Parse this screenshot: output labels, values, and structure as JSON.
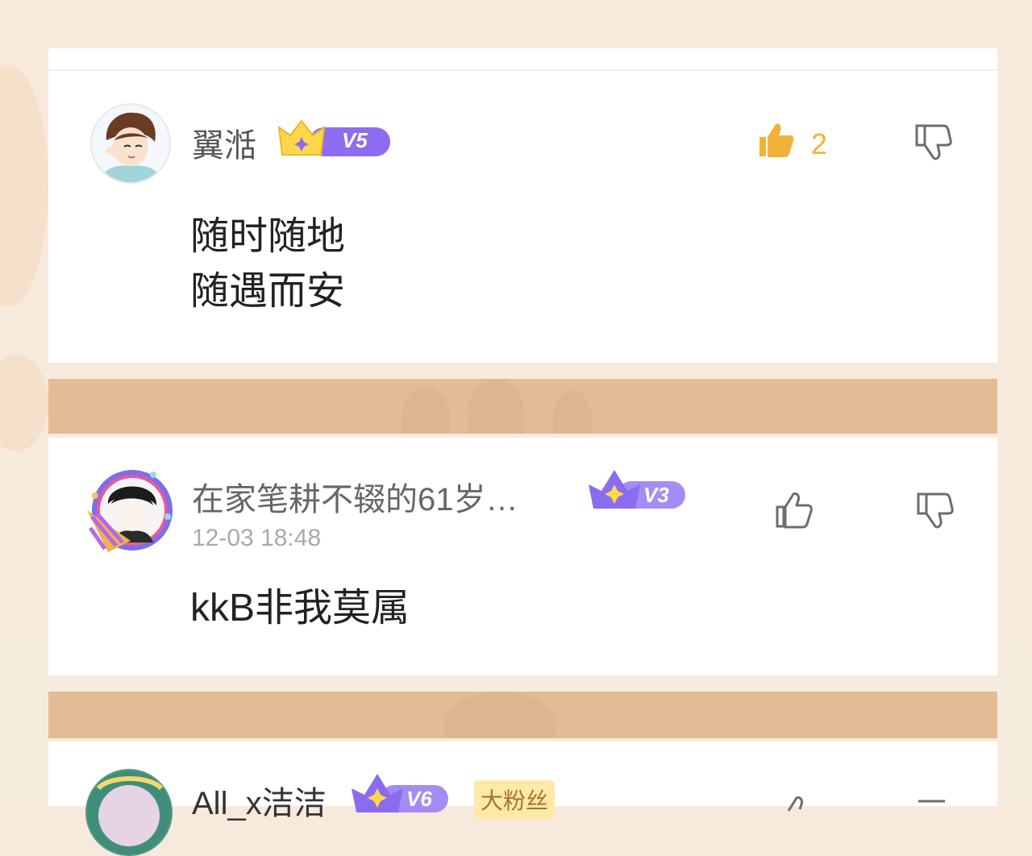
{
  "comments": [
    {
      "name": "翼湉",
      "level": "V5",
      "likes": "2",
      "content_lines": [
        "随时随地",
        "随遇而安"
      ]
    },
    {
      "name": "在家笔耕不辍的61岁…",
      "level": "V3",
      "time": "12-03 18:48",
      "content_lines": [
        "kkB非我莫属"
      ]
    },
    {
      "name": "All_x洁洁",
      "level": "V6",
      "fan_badge": "大粉丝"
    }
  ],
  "colors": {
    "band": "#e1bc95",
    "like_active": "#f1b238",
    "level_badge": "#8e6cf0"
  },
  "icons": [
    "like-icon",
    "dislike-icon",
    "crown-icon",
    "avatar-frame-icon"
  ]
}
